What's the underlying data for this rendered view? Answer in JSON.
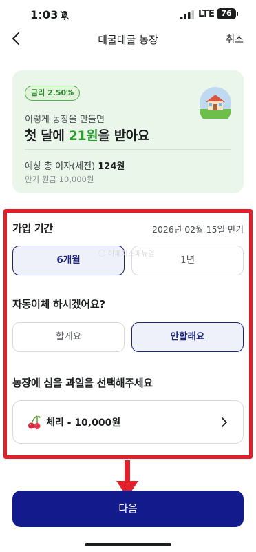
{
  "status_bar": {
    "time": "1:03",
    "network": "LTE",
    "battery": "76"
  },
  "nav": {
    "title": "데굴데굴 농장",
    "cancel_label": "취소"
  },
  "summary": {
    "rate_badge": "금리 2.50%",
    "subtitle": "이렇게 농장을 만들면",
    "headline_prefix": "첫 달에 ",
    "headline_amount": "21원",
    "headline_suffix": "을 받아요",
    "interest_label": "예상 총 이자(세전) ",
    "interest_value": "124원",
    "principal_text": "만기 원금 10,000원"
  },
  "period": {
    "label": "가입 기간",
    "maturity": "2026년 02월 15일 만기",
    "options": [
      "6개월",
      "1년"
    ],
    "selected_index": 0
  },
  "watermark": "이페이스페뉴얼",
  "autotransfer": {
    "label": "자동이체 하시겠어요?",
    "options": [
      "할게요",
      "안할래요"
    ],
    "selected_index": 1
  },
  "fruit": {
    "label": "농장에 심을 과일을 선택해주세요",
    "selection": "체리 - 10,000원"
  },
  "next_label": "다음",
  "colors": {
    "accent_navy": "#131a8c",
    "accent_green": "#2e9b30",
    "highlight_red": "#e2202a"
  }
}
